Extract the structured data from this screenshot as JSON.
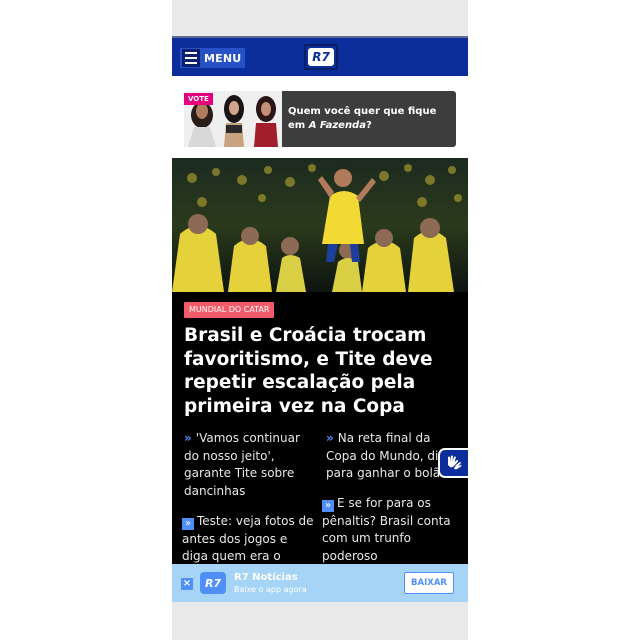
{
  "header": {
    "menu_label": "MENU",
    "logo_text": "R7",
    "background_color": "#0b2e9b"
  },
  "vote": {
    "badge": "VOTE",
    "question_prefix": "Quem você quer que fique em ",
    "question_show": "A Fazenda",
    "question_suffix": "?"
  },
  "article": {
    "tag": "MUNDIAL DO CATAR",
    "headline": "Brasil e Croácia trocam favoritismo, e Tite deve repetir escalação pela primeira vez na Copa",
    "related": [
      {
        "text": "'Vamos continuar do nosso jeito', garante Tite sobre dancinhas",
        "icon": "chevron-right-icon"
      },
      {
        "text": "Na reta final da Copa do Mundo, di para ganhar o bolão",
        "icon": "chevron-right-icon"
      },
      {
        "text": "Teste: veja fotos de antes dos jogos e diga quem era o adversário",
        "icon": "photo-gallery-icon"
      },
      {
        "text": "E se for para os pênaltis? Brasil conta com um trunfo poderoso",
        "icon": "photo-gallery-icon"
      }
    ]
  },
  "app_banner": {
    "close_label": "×",
    "logo_text": "R7",
    "title": "R7 Notícias",
    "subtitle": "Baixe o app agora",
    "button_label": "BAIXAR"
  },
  "accessibility": {
    "icon": "sign-language-icon"
  }
}
